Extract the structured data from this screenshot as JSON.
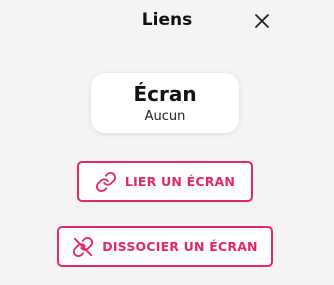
{
  "header": {
    "title": "Liens"
  },
  "screen_card": {
    "title": "Écran",
    "value": "Aucun"
  },
  "actions": {
    "link_label": "LIER UN ÉCRAN",
    "unlink_label": "DISSOCIER UN ÉCRAN"
  },
  "colors": {
    "accent": "#e5266b",
    "background": "#f4f4f5",
    "card": "#ffffff"
  },
  "icons": {
    "close": "close-icon",
    "link": "link-icon",
    "unlink": "unlink-icon"
  }
}
